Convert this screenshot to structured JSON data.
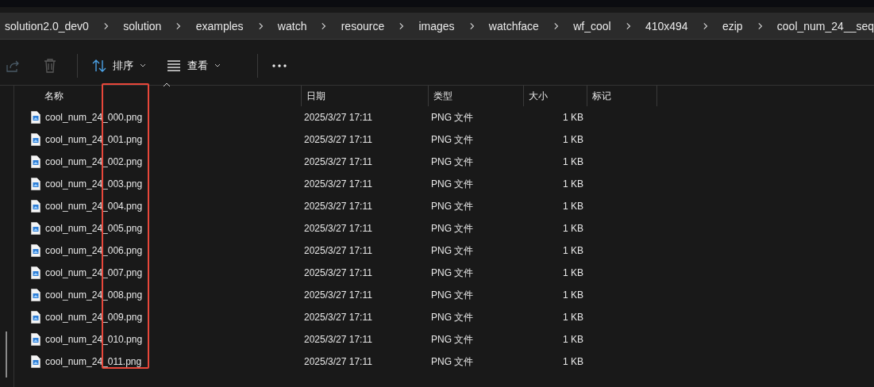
{
  "breadcrumb": [
    "solution2.0_dev0",
    "solution",
    "examples",
    "watch",
    "resource",
    "images",
    "watchface",
    "wf_cool",
    "410x494",
    "ezip",
    "cool_num_24__seq"
  ],
  "toolbar": {
    "share_disabled": true,
    "delete_disabled": true,
    "sort": "排序",
    "view": "查看"
  },
  "columns": [
    {
      "label": "名称",
      "sorted": true
    },
    {
      "label": "日期",
      "sorted": false
    },
    {
      "label": "类型",
      "sorted": false
    },
    {
      "label": "大小",
      "sorted": false
    },
    {
      "label": "标记",
      "sorted": false
    }
  ],
  "rows": [
    {
      "name": "cool_num_24_000.png",
      "date": "2025/3/27 17:11",
      "type": "PNG 文件",
      "size": "1 KB"
    },
    {
      "name": "cool_num_24_001.png",
      "date": "2025/3/27 17:11",
      "type": "PNG 文件",
      "size": "1 KB"
    },
    {
      "name": "cool_num_24_002.png",
      "date": "2025/3/27 17:11",
      "type": "PNG 文件",
      "size": "1 KB"
    },
    {
      "name": "cool_num_24_003.png",
      "date": "2025/3/27 17:11",
      "type": "PNG 文件",
      "size": "1 KB"
    },
    {
      "name": "cool_num_24_004.png",
      "date": "2025/3/27 17:11",
      "type": "PNG 文件",
      "size": "1 KB"
    },
    {
      "name": "cool_num_24_005.png",
      "date": "2025/3/27 17:11",
      "type": "PNG 文件",
      "size": "1 KB"
    },
    {
      "name": "cool_num_24_006.png",
      "date": "2025/3/27 17:11",
      "type": "PNG 文件",
      "size": "1 KB"
    },
    {
      "name": "cool_num_24_007.png",
      "date": "2025/3/27 17:11",
      "type": "PNG 文件",
      "size": "1 KB"
    },
    {
      "name": "cool_num_24_008.png",
      "date": "2025/3/27 17:11",
      "type": "PNG 文件",
      "size": "1 KB"
    },
    {
      "name": "cool_num_24_009.png",
      "date": "2025/3/27 17:11",
      "type": "PNG 文件",
      "size": "1 KB"
    },
    {
      "name": "cool_num_24_010.png",
      "date": "2025/3/27 17:11",
      "type": "PNG 文件",
      "size": "1 KB"
    },
    {
      "name": "cool_num_24_011.png",
      "date": "2025/3/27 17:11",
      "type": "PNG 文件",
      "size": "1 KB"
    }
  ]
}
